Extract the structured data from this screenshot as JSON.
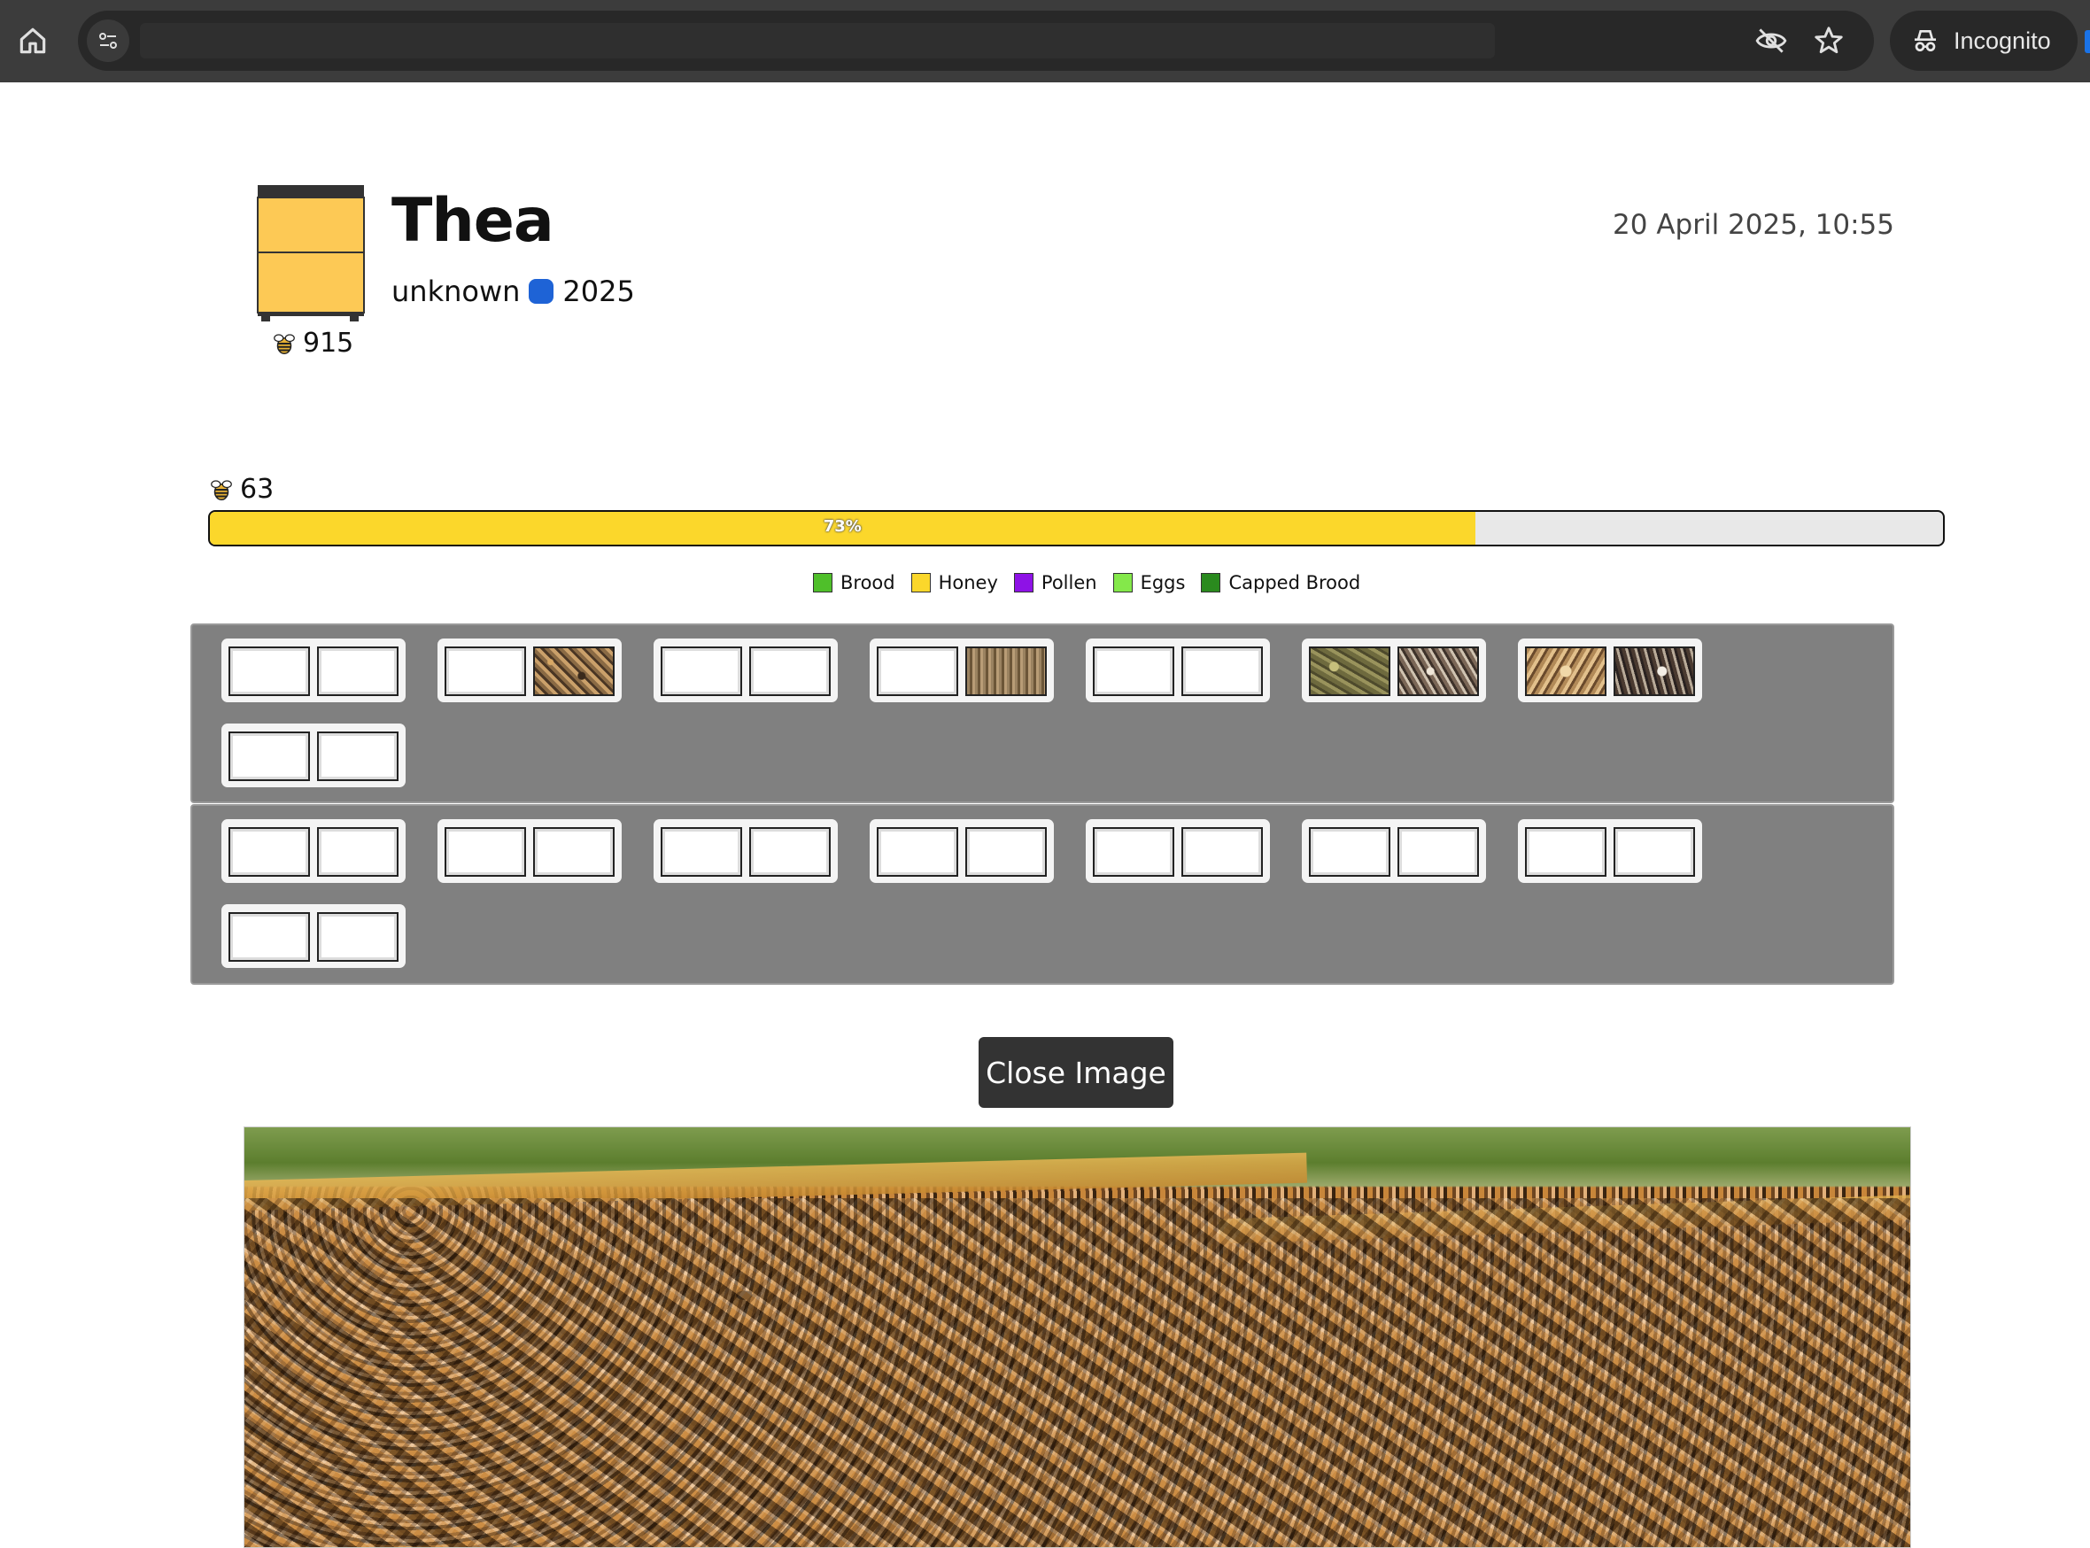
{
  "browser": {
    "incognito_label": "Incognito"
  },
  "hive": {
    "name": "Thea",
    "queen_race": "unknown",
    "queen_year": "2025",
    "bee_count": "915",
    "inspection_date": "20 April 2025, 10:55",
    "queen_color": "#1e63d6",
    "hive_color": "#fdc955"
  },
  "progress": {
    "bee_count": "63",
    "percent_label": "73%",
    "fraction": 0.73,
    "fill_color": "#fbd72b"
  },
  "legend": [
    {
      "label": "Brood",
      "color": "#4fbf2a"
    },
    {
      "label": "Honey",
      "color": "#fbd72b"
    },
    {
      "label": "Pollen",
      "color": "#8e12e6"
    },
    {
      "label": "Eggs",
      "color": "#84e84a"
    },
    {
      "label": "Capped Brood",
      "color": "#2a8a1e"
    }
  ],
  "boxes": [
    {
      "frames": [
        {
          "left": "empty",
          "right": "empty"
        },
        {
          "left": "empty",
          "right": "photo-1"
        },
        {
          "left": "empty",
          "right": "empty"
        },
        {
          "left": "empty",
          "right": "photo-2"
        },
        {
          "left": "empty",
          "right": "empty"
        },
        {
          "left": "photo-3",
          "right": "photo-4"
        },
        {
          "left": "photo-5",
          "right": "photo-6"
        },
        {
          "left": "empty",
          "right": "empty"
        }
      ]
    },
    {
      "frames": [
        {
          "left": "empty",
          "right": "empty"
        },
        {
          "left": "empty",
          "right": "empty"
        },
        {
          "left": "empty",
          "right": "empty"
        },
        {
          "left": "empty",
          "right": "empty"
        },
        {
          "left": "empty",
          "right": "empty"
        },
        {
          "left": "empty",
          "right": "empty"
        },
        {
          "left": "empty",
          "right": "empty"
        },
        {
          "left": "empty",
          "right": "empty"
        }
      ]
    }
  ],
  "actions": {
    "close_image_label": "Close Image"
  },
  "icons": {
    "home": "home-icon",
    "tune": "tune-icon",
    "eye_off": "eye-off-icon",
    "star": "star-icon",
    "incognito": "incognito-icon",
    "bee": "bee-icon"
  }
}
